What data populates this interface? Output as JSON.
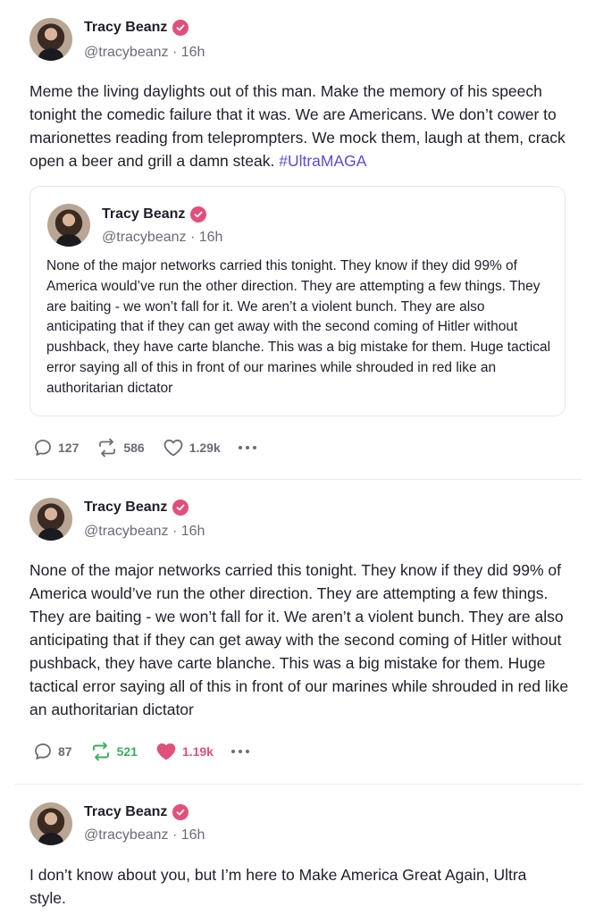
{
  "posts": [
    {
      "author": "Tracy Beanz",
      "handle": "@tracybeanz · 16h",
      "text": "Meme the living daylights out of this man. Make the memory of his speech tonight the comedic failure that it was. We are Americans. We don’t cower to marionettes reading from teleprompters. We mock them, laugh at them, crack open a beer and grill a damn steak.",
      "hashtag": "#UltraMAGA",
      "quote": {
        "author": "Tracy Beanz",
        "handle": "@tracybeanz · 16h",
        "text": "None of the major networks carried this tonight. They know if they did 99% of America would’ve run the other direction. They are attempting a few things. They are baiting - we won’t fall for it. We aren’t a violent bunch. They are also anticipating that if they can get away with the second coming of Hitler without pushback, they have carte blanche. This was a big mistake for them. Huge tactical error saying all of this in front of our marines while shrouded in red like an authoritarian dictator"
      },
      "replies": "127",
      "reposts": "586",
      "likes": "1.29k"
    },
    {
      "author": "Tracy Beanz",
      "handle": "@tracybeanz · 16h",
      "text": "None of the major networks carried this tonight. They know if they did 99% of America would’ve run the other direction. They are attempting a few things. They are baiting - we won’t fall for it. We aren’t a violent bunch. They are also anticipating that if they can get away with the second coming of Hitler without pushback, they have carte blanche. This was a big mistake for them. Huge tactical error saying all of this in front of our marines while shrouded in red like an authoritarian dictator",
      "replies": "87",
      "reposts": "521",
      "likes": "1.19k"
    },
    {
      "author": "Tracy Beanz",
      "handle": "@tracybeanz · 16h",
      "text": "I don’t know about you, but I’m here to Make America Great Again, Ultra style."
    }
  ],
  "colors": {
    "accent": "#5b4bd6",
    "verified": "#e0507a",
    "repost_active": "#3cae5d",
    "like_active": "#e0507a"
  }
}
